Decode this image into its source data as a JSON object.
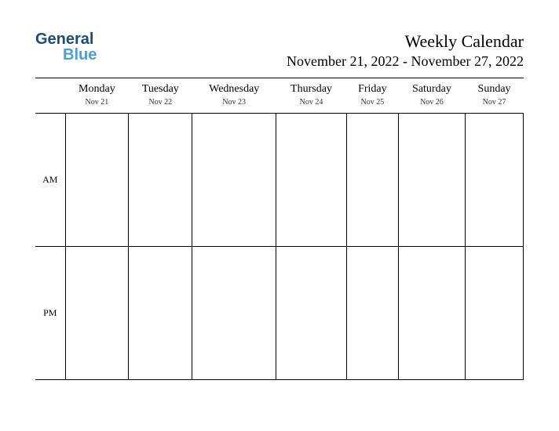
{
  "logo": {
    "text_top": "General",
    "text_bottom": "Blue"
  },
  "header": {
    "title": "Weekly Calendar",
    "date_range": "November 21, 2022 - November 27, 2022"
  },
  "days": [
    {
      "name": "Monday",
      "date": "Nov 21"
    },
    {
      "name": "Tuesday",
      "date": "Nov 22"
    },
    {
      "name": "Wednesday",
      "date": "Nov 23"
    },
    {
      "name": "Thursday",
      "date": "Nov 24"
    },
    {
      "name": "Friday",
      "date": "Nov 25"
    },
    {
      "name": "Saturday",
      "date": "Nov 26"
    },
    {
      "name": "Sunday",
      "date": "Nov 27"
    }
  ],
  "time_periods": {
    "am": "AM",
    "pm": "PM"
  }
}
